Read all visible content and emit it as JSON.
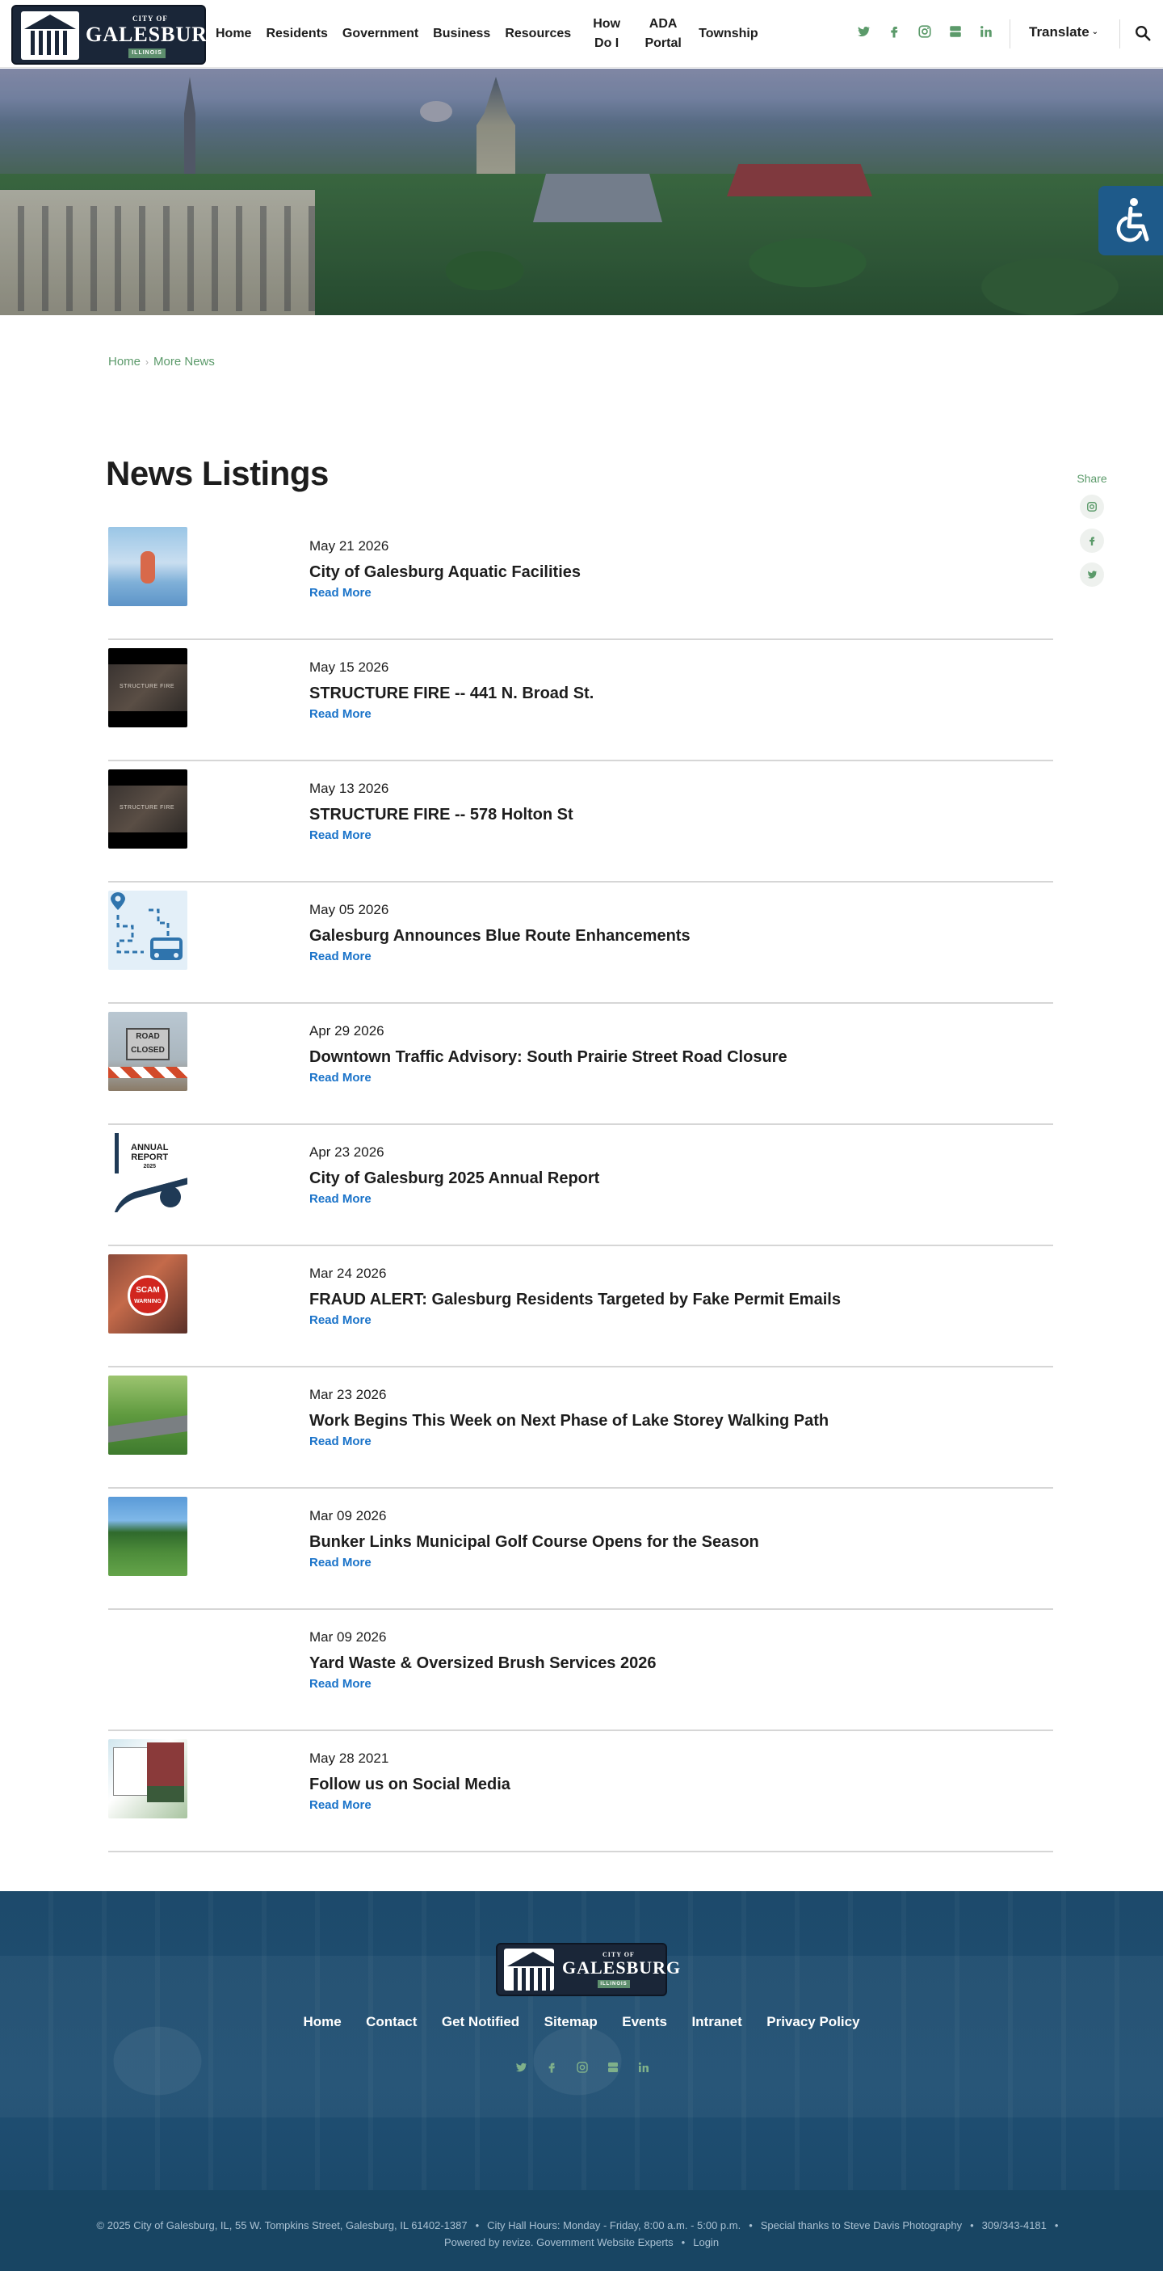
{
  "header": {
    "logo": {
      "small": "CITY OF",
      "main": "GALESBURG",
      "state": "ILLINOIS"
    },
    "nav": [
      {
        "label": "Home"
      },
      {
        "label": "Residents"
      },
      {
        "label": "Government"
      },
      {
        "label": "Business"
      },
      {
        "label": "Resources"
      },
      {
        "label_l1": "How",
        "label_l2": "Do I"
      },
      {
        "label_l1": "ADA",
        "label_l2": "Portal"
      },
      {
        "label": "Township"
      }
    ],
    "socials": [
      "twitter-icon",
      "facebook-icon",
      "instagram-icon",
      "youtube-icon",
      "linkedin-icon"
    ],
    "translate_label": "Translate"
  },
  "breadcrumb": {
    "home": "Home",
    "current": "More News"
  },
  "page_title": "News Listings",
  "share": {
    "label": "Share",
    "icons": [
      "instagram-icon",
      "facebook-icon",
      "twitter-icon"
    ]
  },
  "news": [
    {
      "date": "May 21 2026",
      "title": "City of Galesburg Aquatic Facilities",
      "more": "Read More"
    },
    {
      "date": "May 15 2026",
      "title": "STRUCTURE FIRE -- 441 N. Broad St.",
      "more": "Read More"
    },
    {
      "date": "May 13 2026",
      "title": "STRUCTURE FIRE -- 578 Holton St",
      "more": "Read More"
    },
    {
      "date": "May 05 2026",
      "title": "Galesburg Announces Blue Route Enhancements",
      "more": "Read More"
    },
    {
      "date": "Apr 29 2026",
      "title": "Downtown Traffic Advisory: South Prairie Street Road Closure",
      "more": "Read More"
    },
    {
      "date": "Apr 23 2026",
      "title": "City of Galesburg 2025 Annual Report",
      "more": "Read More"
    },
    {
      "date": "Mar 24 2026",
      "title": "FRAUD ALERT: Galesburg Residents Targeted by Fake Permit Emails",
      "more": "Read More"
    },
    {
      "date": "Mar 23 2026",
      "title": "Work Begins This Week on Next Phase of Lake Storey Walking Path",
      "more": "Read More"
    },
    {
      "date": "Mar 09 2026",
      "title": "Bunker Links Municipal Golf Course Opens for the Season",
      "more": "Read More"
    },
    {
      "date": "Mar 09 2026",
      "title": "Yard Waste & Oversized Brush Services 2026",
      "more": "Read More"
    },
    {
      "date": "May 28 2021",
      "title": "Follow us on Social Media",
      "more": "Read More"
    }
  ],
  "thumbs": {
    "fire_text": "STRUCTURE FIRE",
    "road_text_1": "ROAD",
    "road_text_2": "CLOSED",
    "annual_text_1": "ANNUAL",
    "annual_text_2": "REPORT",
    "annual_text_3": "2025",
    "scam_text_1": "SCAM",
    "scam_text_2": "WARNING"
  },
  "footer": {
    "nav": [
      "Home",
      "Contact",
      "Get Notified",
      "Sitemap",
      "Events",
      "Intranet",
      "Privacy Policy"
    ],
    "socials": [
      "twitter-icon",
      "facebook-icon",
      "instagram-icon",
      "youtube-icon",
      "linkedin-icon"
    ],
    "copyright": "© 2025 City of Galesburg, IL, 55 W. Tompkins Street, Galesburg, IL 61402-1387",
    "hours": "City Hall Hours: Monday - Friday, 8:00 a.m. - 5:00 p.m.",
    "thanks": "Special thanks to Steve Davis Photography",
    "phone": "309/343-4181",
    "powered": "Powered by revize. Government Website Experts",
    "login": "Login"
  }
}
